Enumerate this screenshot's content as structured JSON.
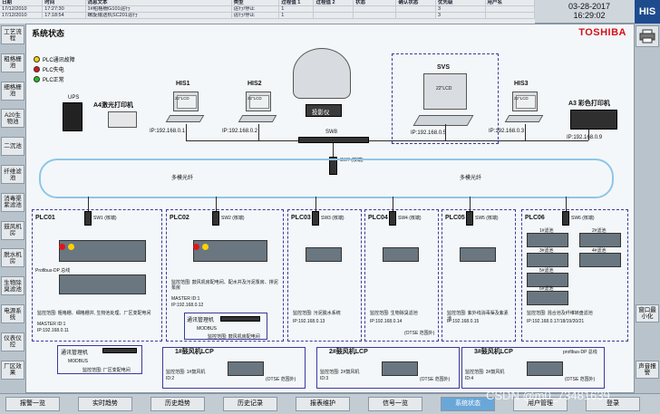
{
  "alarms": {
    "headers": [
      "日期",
      "时间",
      "消息文本",
      "类型",
      "过程值 1",
      "过程值 2",
      "状态",
      "确认状态",
      "优先级",
      "用户名"
    ],
    "rows": [
      [
        "17/12/2010",
        "17:27:30",
        "1#粗格栅G101运行",
        "运行/停止",
        "1",
        "",
        "",
        "",
        "3",
        ""
      ],
      [
        "17/12/2010",
        "17:18:54",
        "螺旋输送机SC201运行",
        "运行/停止",
        "1",
        "",
        "",
        "",
        "3",
        ""
      ]
    ]
  },
  "header": {
    "date": "03-28-2017",
    "time": "16:29:02",
    "logo": "HIS"
  },
  "main": {
    "title": "系统状态",
    "brand": "TOSHIBA"
  },
  "legend": [
    {
      "label": "PLC通讯故障",
      "color": "#ffd200"
    },
    {
      "label": "PLC失电",
      "color": "#e0151b"
    },
    {
      "label": "PLC正常",
      "color": "#23c21e"
    }
  ],
  "left_nav": [
    "工艺流程",
    "粗格栅池",
    "细格栅池",
    "A20生物池",
    "二沉池",
    "纤维滤池",
    "消毒渠紫滤池",
    "鼓风机房",
    "脱水机房",
    "生物除臭滤池",
    "电源系统",
    "仪表仪控",
    "厂区效果"
  ],
  "right_nav": [
    "窗口最小化",
    "声音报警"
  ],
  "bottom_nav": [
    "报警一览",
    "实时趋势",
    "历史趋势",
    "历史记录",
    "报表维护",
    "信号一览",
    "系统状态",
    "用户管理",
    "登录"
  ],
  "bottom_active": "系统状态",
  "watermark": "CSDN @m0_73481639",
  "devices": {
    "ups": "UPS",
    "a4printer": "A4激光打印机",
    "his1": "HIS1",
    "his1_ip": "IP:192.168.0.1",
    "his2": "HIS2",
    "his2_ip": "IP:192.168.0.2",
    "projector": "投影仪",
    "svs": "SVS",
    "svs_ip": "IP:192.168.0.5",
    "his3": "HIS3",
    "his3_ip": "IP:192.168.0.3",
    "a3printer": "A3 彩色打印机",
    "a3_ip": "IP:192.168.0.9",
    "sw8": "SW8",
    "sw7": "SW7 (核端)",
    "fiber_left": "多模光纤",
    "fiber_right": "多模光纤",
    "screen_text": "22\"LCD",
    "sw_core": "(核端)"
  },
  "plcs": [
    {
      "name": "PLC01",
      "sw": "SW1 (核端)",
      "range": "监控范围: 粗格栅、细格栅井, 生物池处理、厂区变配电间",
      "master": "MASTER ID:1",
      "ip": "IP:192.168.0.11",
      "profibus": "Profibus-DP 总线"
    },
    {
      "name": "PLC02",
      "sw": "SW2 (核端)",
      "range": "监控范围: 鼓风机房配电间、配水井及污泥泵房、排泥泵房",
      "master": "MASTER ID:1",
      "ip": "IP:192.168.0.12"
    },
    {
      "name": "PLC03",
      "sw": "SW3 (核端)",
      "range": "监控范围: 污泥脱水系统",
      "ip": "IP:192.168.0.13"
    },
    {
      "name": "PLC04",
      "sw": "SW4 (核端)",
      "range": "监控范围: 生物除臭滤池",
      "ip": "IP:192.168.0.14",
      "note": "(OTSE 范围外)"
    },
    {
      "name": "PLC05",
      "sw": "SW5 (核端)",
      "range": "监控范围: 紫外线消毒渠及紫素池",
      "ip": "IP:192.168.0.15"
    },
    {
      "name": "PLC06",
      "sw": "SW6 (核端)",
      "range": "监控范围: 混合池及纤维转盘滤池",
      "ip": "IP:192.168.0.17/18/19/20/21",
      "sub": [
        "1#滤池",
        "2#滤池",
        "3#滤池",
        "4#滤池",
        "5#滤池",
        "6#滤池"
      ]
    }
  ],
  "blowers": [
    {
      "name": "1#鼓风机LCP",
      "range": "监控范围: 1#鼓风机",
      "id": "ID:2",
      "note": "(OTSE 范围外)"
    },
    {
      "name": "2#鼓风机LCP",
      "range": "监控范围: 2#鼓风机",
      "id": "ID:3",
      "note": "(OTSE 范围外)"
    },
    {
      "name": "3#鼓风机LCP",
      "range": "监控范围: 3#鼓风机",
      "id": "ID:4",
      "note": "(OTSE 范围外)",
      "profibus": "profibus-DP 总线"
    }
  ],
  "sub_units": {
    "comm1": "通讯管理机",
    "comm1_bus": "MODBUS",
    "comm1_range": "监控范围: 厂区变配电间",
    "comm2": "通讯管理机",
    "comm2_bus": "MODBUS",
    "comm2_range": "监控范围: 鼓风机房配电间"
  }
}
